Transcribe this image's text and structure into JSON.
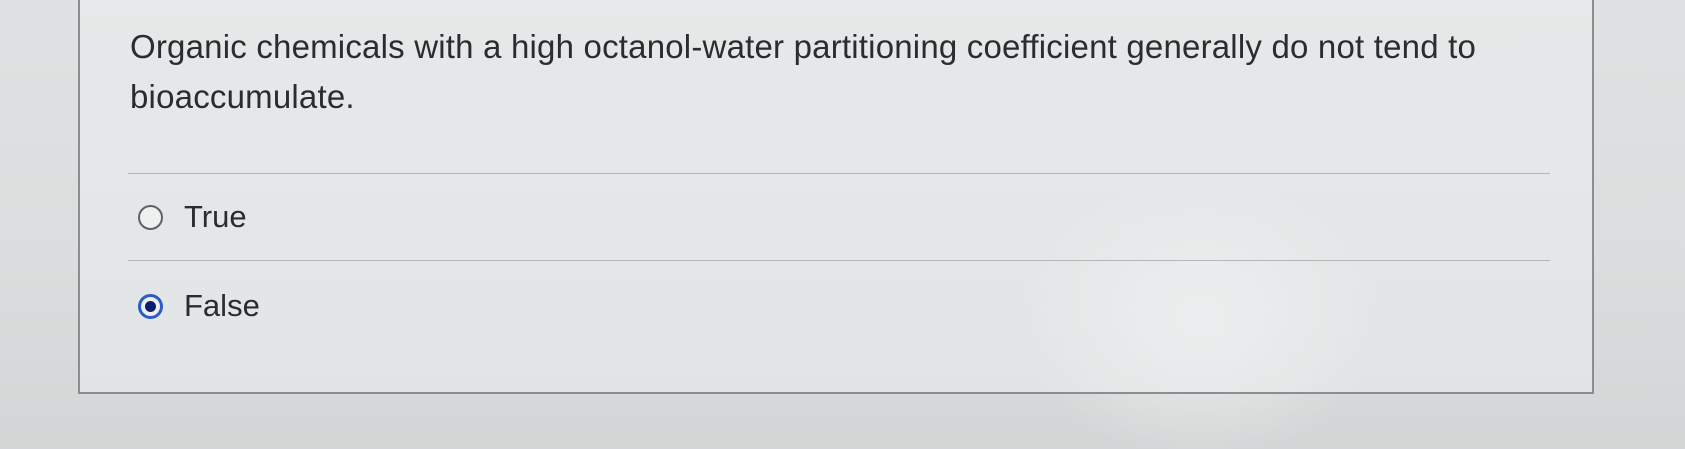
{
  "question": {
    "text": "Organic chemicals with a high octanol-water partitioning coefficient generally do not tend to bioaccumulate."
  },
  "options": [
    {
      "label": "True",
      "selected": false
    },
    {
      "label": "False",
      "selected": true
    }
  ],
  "colors": {
    "radio_selected_ring": "#2b5cc7",
    "radio_selected_dot": "#0b1f6e",
    "text": "#2a2d30"
  }
}
